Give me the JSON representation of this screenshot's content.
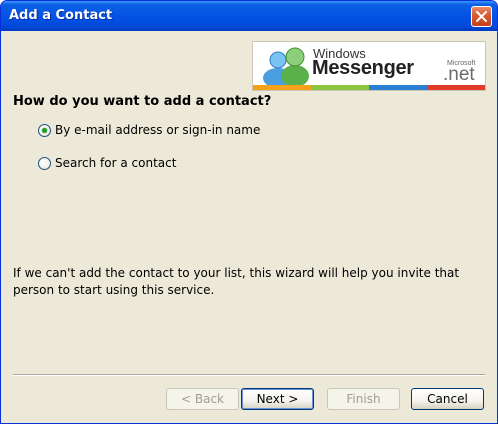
{
  "window": {
    "title": "Add a Contact"
  },
  "banner": {
    "brand_top": "Windows",
    "brand_main": "Messenger",
    "brand_small": "Microsoft",
    "brand_net": ".net"
  },
  "question": "How do you want to add a contact?",
  "options": [
    {
      "label": "By e-mail address or sign-in name",
      "checked": true
    },
    {
      "label": "Search for a contact",
      "checked": false
    }
  ],
  "info_text": "If we can't add the contact to your list, this wizard will help you invite that person to start using this service.",
  "buttons": {
    "back": "< Back",
    "next": "Next >",
    "finish": "Finish",
    "cancel": "Cancel"
  },
  "colors": {
    "titlebar": "#0553e6",
    "face": "#ece9d8",
    "close": "#d9582d"
  }
}
